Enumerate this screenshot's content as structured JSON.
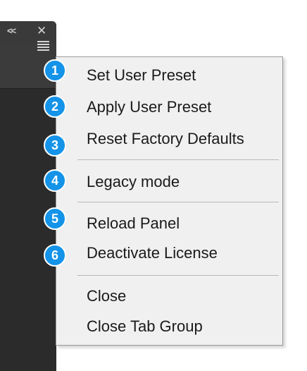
{
  "panel": {
    "collapse_glyph": "<<",
    "close_glyph": "✕"
  },
  "menu": {
    "items": [
      {
        "label": "Set User Preset",
        "badge": "1"
      },
      {
        "label": "Apply User Preset",
        "badge": "2"
      },
      {
        "label": "Reset Factory Defaults",
        "badge": "3"
      },
      {
        "label": "Legacy mode",
        "badge": "4"
      },
      {
        "label": "Reload Panel",
        "badge": "5"
      },
      {
        "label": "Deactivate License",
        "badge": "6"
      },
      {
        "label": "Close"
      },
      {
        "label": "Close Tab Group"
      }
    ]
  },
  "colors": {
    "badge": "#1493e8",
    "panel": "#2b2b2b",
    "menu_bg": "#f0f0f0"
  }
}
